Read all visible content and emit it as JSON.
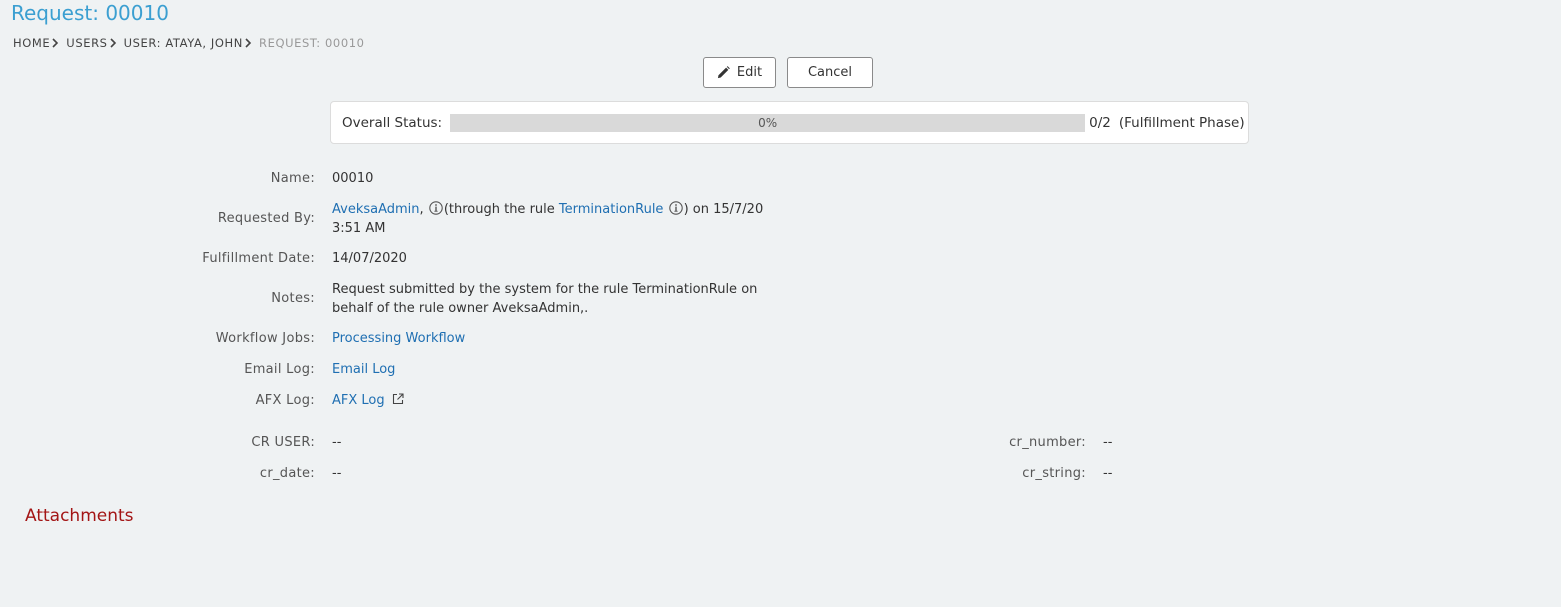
{
  "page": {
    "title": "Request: 00010"
  },
  "breadcrumb": [
    {
      "label": "HOME"
    },
    {
      "label": "USERS"
    },
    {
      "label": "USER: ATAYA, JOHN"
    },
    {
      "label": "REQUEST: 00010"
    }
  ],
  "toolbar": {
    "edit_label": "Edit",
    "edit_icon": "pencil-icon",
    "cancel_label": "Cancel"
  },
  "status": {
    "label": "Overall Status:",
    "progress_percent": 0,
    "progress_text": "0%",
    "count": "0/2",
    "phase": "(Fulfillment Phase)"
  },
  "fields": {
    "name": {
      "label": "Name:",
      "value": "00010"
    },
    "requested_by": {
      "label": "Requested By:",
      "user": "AveksaAdmin",
      "comma": ",",
      "through_text": "(through the rule",
      "rule": "TerminationRule",
      "on_text": ") on 15/7/20",
      "time": "3:51 AM"
    },
    "fulfillment_date": {
      "label": "Fulfillment Date:",
      "value": "14/07/2020"
    },
    "notes": {
      "label": "Notes:",
      "line1": "Request submitted by the system for the rule TerminationRule on",
      "line2": "behalf of the rule owner AveksaAdmin,."
    },
    "workflow_jobs": {
      "label": "Workflow Jobs:",
      "value": "Processing Workflow"
    },
    "email_log": {
      "label": "Email Log:",
      "value": "Email Log"
    },
    "afx_log": {
      "label": "AFX Log:",
      "value": "AFX Log"
    },
    "cr_user": {
      "label": "CR USER:",
      "value": "--"
    },
    "cr_date": {
      "label": "cr_date:",
      "value": "--"
    },
    "cr_number": {
      "label": "cr_number:",
      "value": "--"
    },
    "cr_string": {
      "label": "cr_string:",
      "value": "--"
    }
  },
  "attachments": {
    "title": "Attachments"
  },
  "colors": {
    "title": "#3b9fd1",
    "link": "#1f6fb2",
    "section_title": "#a31515",
    "background": "#eff2f3"
  }
}
